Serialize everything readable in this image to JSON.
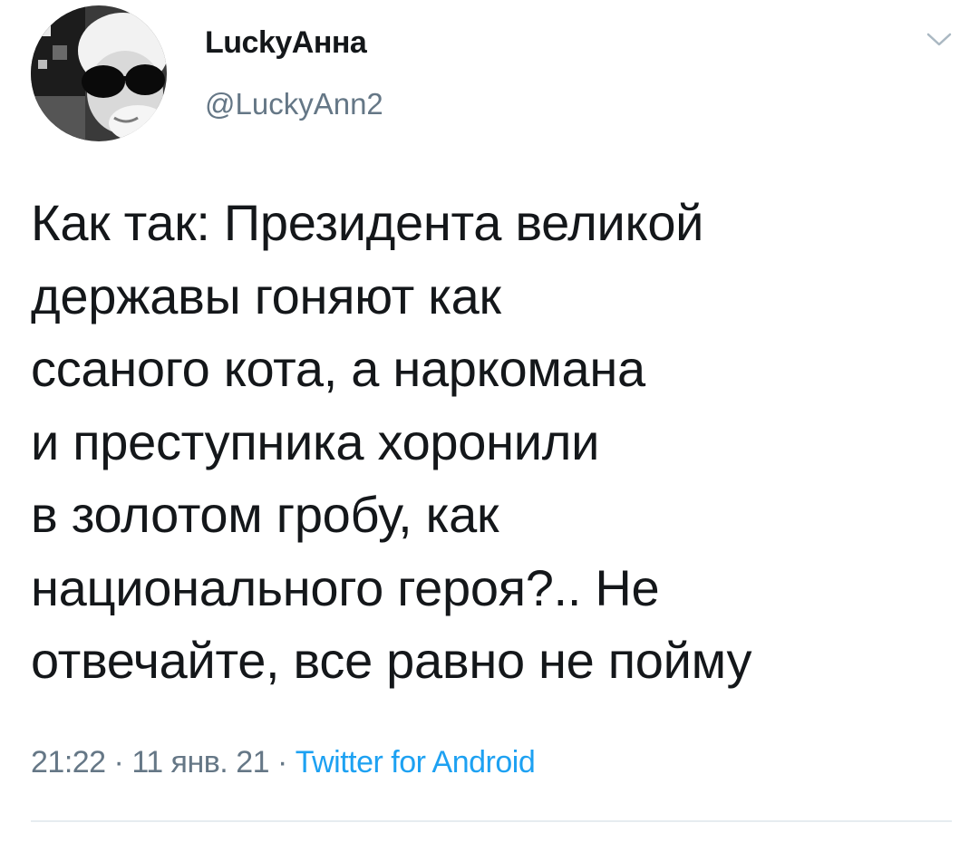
{
  "tweet": {
    "author": {
      "display_name": "LuckyАнна",
      "handle": "@LuckyAnn2",
      "avatar_icon": "user-avatar-photo"
    },
    "menu_icon": "chevron-down-icon",
    "text": "Как так: Президента великой\nдержавы гоняют как\nссаного кота, а наркомана\nи преступника хоронили\nв золотом гробу, как\nнационального героя?.. Не\nотвечайте, все равно не пойму",
    "time": "21:22",
    "separator": " · ",
    "date": "11 янв. 21",
    "source": "Twitter for Android"
  },
  "colors": {
    "text_primary": "#14171a",
    "text_secondary": "#657786",
    "link": "#1da1f2",
    "divider": "#e6ecf0"
  }
}
